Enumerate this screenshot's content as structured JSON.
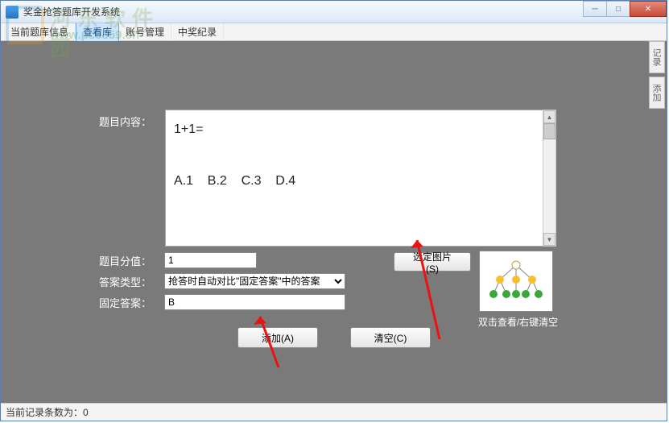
{
  "window": {
    "title": "奖金抢答题库开发系统"
  },
  "menu": {
    "items": [
      "当前题库信息",
      "查看库",
      "账号管理",
      "中奖纪录"
    ],
    "active_index": 1
  },
  "side_tabs": [
    "记录",
    "添加"
  ],
  "form": {
    "content_label": "题目内容：",
    "content_text": "1+1=\n\nA.1    B.2    C.3    D.4",
    "score_label": "题目分值：",
    "score_value": "1",
    "type_label": "答案类型：",
    "type_value": "抢答时自动对比\"固定答案\"中的答案",
    "fixed_label": "固定答案：",
    "fixed_value": "B",
    "select_image_btn": "选定图片(S)",
    "add_btn": "添加(A)",
    "clear_btn": "清空(C)",
    "image_caption": "双击查看/右键清空"
  },
  "status": {
    "text": "当前记录条数为：0"
  },
  "watermark": {
    "line1": "河东软件园",
    "line2": "www.pc0359.cn"
  }
}
